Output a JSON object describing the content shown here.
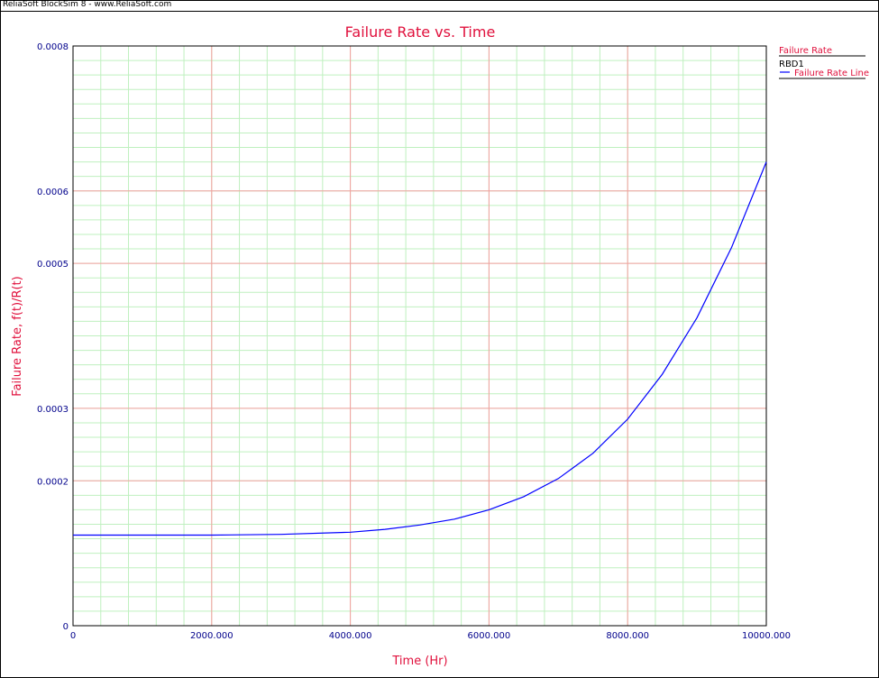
{
  "header": {
    "text": "ReliaSoft BlockSim 8 - www.ReliaSoft.com"
  },
  "colors": {
    "title": "#e0103c",
    "axis_text": "#00008b",
    "line": "#0000ff",
    "major_grid": "#f4a0a0",
    "minor_grid": "#bff0bf",
    "legend_black": "#000000"
  },
  "chart_data": {
    "type": "line",
    "title": "Failure Rate vs. Time",
    "xlabel": "Time (Hr)",
    "ylabel": "Failure Rate, f(t)/R(t)",
    "xlim": [
      0,
      10000
    ],
    "ylim": [
      0,
      0.0008
    ],
    "x_ticks": [
      0,
      2000,
      4000,
      6000,
      8000,
      10000
    ],
    "x_tick_labels": [
      "0",
      "2000.000",
      "4000.000",
      "6000.000",
      "8000.000",
      "10000.000"
    ],
    "y_ticks": [
      0,
      0.0002,
      0.0003,
      0.0005,
      0.0006,
      0.0008
    ],
    "y_tick_labels": [
      "0",
      "0.0002",
      "0.0003",
      "0.0005",
      "0.0006",
      "0.0008"
    ],
    "grid": true,
    "legend": {
      "placement": "right",
      "heading": "Failure Rate",
      "group": "RBD1",
      "entry": "Failure Rate Line"
    },
    "series": [
      {
        "name": "Failure Rate Line",
        "x": [
          0,
          1000,
          2000,
          3000,
          4000,
          4500,
          5000,
          5500,
          6000,
          6500,
          7000,
          7500,
          8000,
          8500,
          9000,
          9500,
          10000
        ],
        "y": [
          0.000125,
          0.000125,
          0.000125,
          0.000126,
          0.000129,
          0.000133,
          0.000139,
          0.000147,
          0.00016,
          0.000178,
          0.000203,
          0.000238,
          0.000285,
          0.000347,
          0.000425,
          0.000522,
          0.00064
        ]
      }
    ]
  }
}
